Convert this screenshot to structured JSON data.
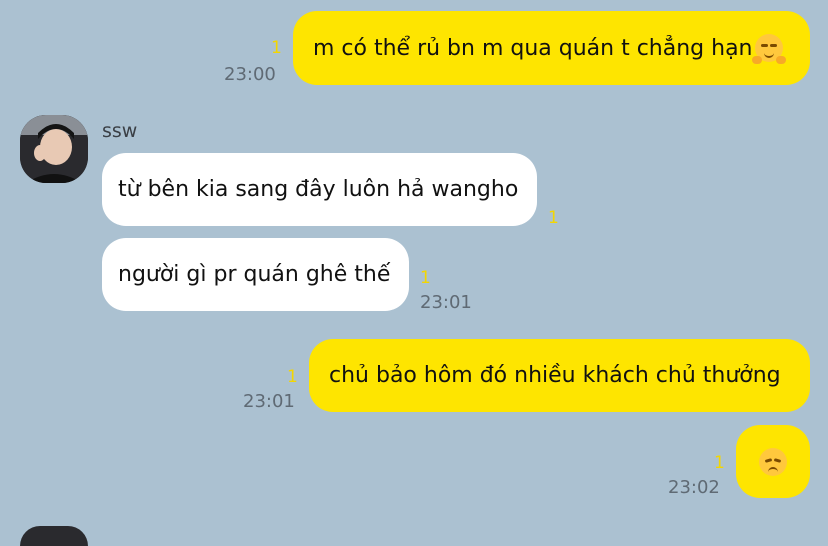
{
  "messages": [
    {
      "text": "m có thể rủ bn m qua quán t chẳng hạn",
      "emoji": "hugging-face",
      "unread": "1",
      "time": "23:00"
    },
    {
      "text": "từ bên kia sang đây luôn hả wangho",
      "unread": "1"
    },
    {
      "text": "người gì pr quán ghê thế",
      "unread": "1",
      "time": "23:01"
    },
    {
      "text": "chủ bảo hôm đó nhiều khách chủ thưởng",
      "unread": "1",
      "time": "23:01"
    },
    {
      "emoji": "pensive-face",
      "unread": "1",
      "time": "23:02"
    }
  ],
  "sender": {
    "name": "ssw"
  }
}
